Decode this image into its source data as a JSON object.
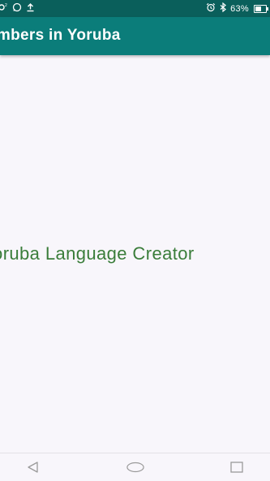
{
  "status_bar": {
    "battery_percent": "63%",
    "left_icons": [
      "notification-icon",
      "whatsapp-icon",
      "upload-icon"
    ],
    "right_icons": [
      "alarm-icon",
      "bluetooth-icon",
      "battery-icon"
    ]
  },
  "app_bar": {
    "title": "Numbers in Yoruba"
  },
  "main": {
    "center_text": "Yoruba Language Creator"
  },
  "nav_bar": {
    "buttons": [
      "back-icon",
      "home-icon",
      "recents-icon"
    ]
  },
  "colors": {
    "status_bar": "#0a5f5b",
    "app_bar": "#0b7d7a",
    "center_text": "#3a7d3a",
    "background": "#f8f6fb"
  }
}
